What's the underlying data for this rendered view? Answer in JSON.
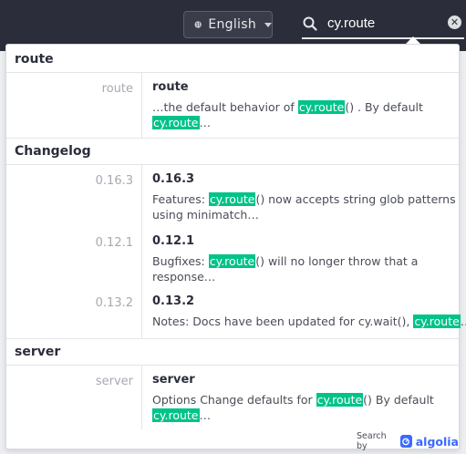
{
  "header": {
    "language_button": "English",
    "search": {
      "value": "cy.route",
      "placeholder": ""
    }
  },
  "results": {
    "groups": [
      {
        "category": "route",
        "hits": [
          {
            "left_label": "route",
            "title": "route",
            "snippet": [
              {
                "t": "…the default behavior of "
              },
              {
                "t": "cy.route",
                "hl": true
              },
              {
                "t": "() . By default "
              },
              {
                "t": "cy.route",
                "hl": true
              },
              {
                "t": "…"
              }
            ]
          }
        ]
      },
      {
        "category": "Changelog",
        "hits": [
          {
            "left_label": "0.16.3",
            "title": "0.16.3",
            "snippet": [
              {
                "t": "Features: "
              },
              {
                "t": "cy.route",
                "hl": true
              },
              {
                "t": "() now accepts string glob patterns using minimatch…"
              }
            ]
          },
          {
            "left_label": "0.12.1",
            "title": "0.12.1",
            "snippet": [
              {
                "t": "Bugfixes: "
              },
              {
                "t": "cy.route",
                "hl": true
              },
              {
                "t": "() will no longer throw that a response…"
              }
            ]
          },
          {
            "left_label": "0.13.2",
            "title": "0.13.2",
            "snippet": [
              {
                "t": "Notes: Docs have been updated for cy.wait(), "
              },
              {
                "t": "cy.route",
                "hl": true
              },
              {
                "t": "…"
              }
            ]
          }
        ]
      },
      {
        "category": "server",
        "hits": [
          {
            "left_label": "server",
            "title": "server",
            "snippet": [
              {
                "t": "Options Change defaults for "
              },
              {
                "t": "cy.route",
                "hl": true
              },
              {
                "t": "() By default "
              },
              {
                "t": "cy.route",
                "hl": true
              },
              {
                "t": "…"
              }
            ]
          }
        ]
      }
    ]
  },
  "footer": {
    "label": "Search by",
    "brand": "algolia"
  },
  "colors": {
    "highlight": "#00c389",
    "topbar": "#2b2e3a",
    "algolia": "#3b69ff"
  }
}
